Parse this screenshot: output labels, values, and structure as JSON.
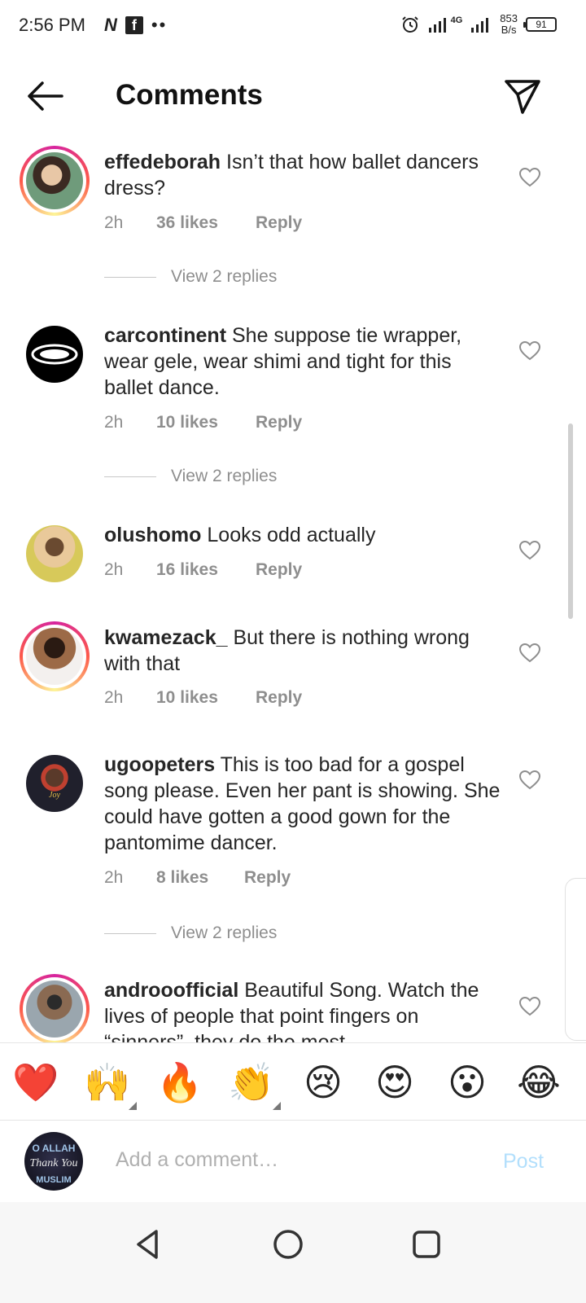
{
  "status_bar": {
    "time": "2:56 PM",
    "net_speed_value": "853",
    "net_speed_unit": "B/s",
    "battery": "91",
    "signal_label": "4G"
  },
  "header": {
    "title": "Comments"
  },
  "comments": [
    {
      "username": "effedeborah",
      "text": "Isn’t that how ballet dancers dress?",
      "time": "2h",
      "likes": "36 likes",
      "reply": "Reply",
      "view_replies": "View 2 replies",
      "avatar_color": "#4a6d5a"
    },
    {
      "username": "carcontinent",
      "text": "She suppose tie wrapper, wear gele, wear shimi and tight for this ballet dance.",
      "time": "2h",
      "likes": "10 likes",
      "reply": "Reply",
      "view_replies": "View 2 replies",
      "avatar_color": "#000000"
    },
    {
      "username": "olushomo",
      "text": "Looks odd actually",
      "time": "2h",
      "likes": "16 likes",
      "reply": "Reply",
      "avatar_color": "#c9b06a"
    },
    {
      "username": "kwamezack_",
      "text": "But there is nothing wrong with that",
      "time": "2h",
      "likes": "10 likes",
      "reply": "Reply",
      "avatar_color": "#8a5a3c"
    },
    {
      "username": "ugoopeters",
      "text": "This is too bad for a gospel song please. Even her pant is showing. She could have gotten a good gown for the pantomime dancer.",
      "time": "2h",
      "likes": "8 likes",
      "reply": "Reply",
      "view_replies": "View 2 replies",
      "avatar_color": "#1a1a22"
    },
    {
      "username": "androoofficial",
      "text": "Beautiful Song. Watch the lives of people that point fingers on “sinners”, they do the most",
      "avatar_color": "#7a8a95"
    }
  ],
  "emoji_bar": [
    "❤️",
    "🙌",
    "🔥",
    "👏",
    "😢",
    "😍",
    "😮",
    "😂"
  ],
  "composer": {
    "placeholder": "Add a comment…",
    "post_label": "Post"
  },
  "colors": {
    "post_disabled": "#b2dffc",
    "meta_gray": "#8e8e8e",
    "heart_gray": "#8e8e8e"
  }
}
